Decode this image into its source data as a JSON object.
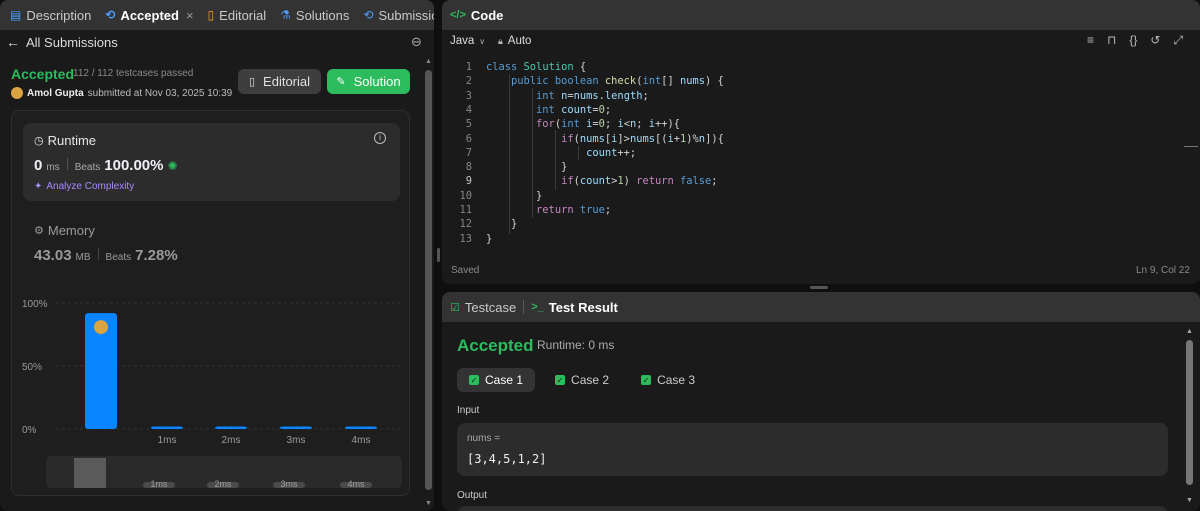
{
  "left_tabs": {
    "description": "Description",
    "accepted": "Accepted",
    "editorial": "Editorial",
    "solutions": "Solutions",
    "submissions": "Submissions"
  },
  "submission_header": {
    "back_label": "All Submissions"
  },
  "result": {
    "status": "Accepted",
    "testcases": "112 / 112 testcases passed",
    "user": "Amol Gupta",
    "submitted_text": "submitted at Nov 03, 2025 10:39",
    "editorial_button": "Editorial",
    "solution_button": "Solution"
  },
  "runtime": {
    "label": "Runtime",
    "value": "0",
    "unit": "ms",
    "beats_label": "Beats",
    "beats_value": "100.00%",
    "analyze": "Analyze Complexity"
  },
  "memory": {
    "label": "Memory",
    "value": "43.03",
    "unit": "MB",
    "beats_label": "Beats",
    "beats_value": "7.28%"
  },
  "chart_data": {
    "type": "bar",
    "categories": [
      "",
      "1ms",
      "2ms",
      "3ms",
      "4ms"
    ],
    "values": [
      92,
      2,
      2,
      2,
      2
    ],
    "ytick_labels": [
      "100%",
      "50%",
      "0%"
    ],
    "ylim": [
      0,
      100
    ],
    "bar_color": "#0a84ff",
    "mini_labels": [
      "1ms",
      "2ms",
      "3ms",
      "4ms"
    ]
  },
  "code_panel": {
    "title": "Code",
    "language": "Java",
    "mode": "Auto",
    "status": "Saved",
    "cursor": "Ln 9, Col 22",
    "line_numbers": [
      "1",
      "2",
      "3",
      "4",
      "5",
      "6",
      "7",
      "8",
      "9",
      "10",
      "11",
      "12",
      "13"
    ]
  },
  "test_panel": {
    "testcase_tab": "Testcase",
    "result_tab": "Test Result",
    "status": "Accepted",
    "runtime": "Runtime: 0 ms",
    "cases": [
      "Case 1",
      "Case 2",
      "Case 3"
    ],
    "input_label": "Input",
    "var_name": "nums =",
    "var_value": "[3,4,5,1,2]",
    "output_label": "Output"
  },
  "colors": {
    "accent_green": "#2cbb5d",
    "accent_blue": "#0a84ff",
    "panel_bg": "#1a1a1a",
    "tabbar_bg": "#333333"
  }
}
